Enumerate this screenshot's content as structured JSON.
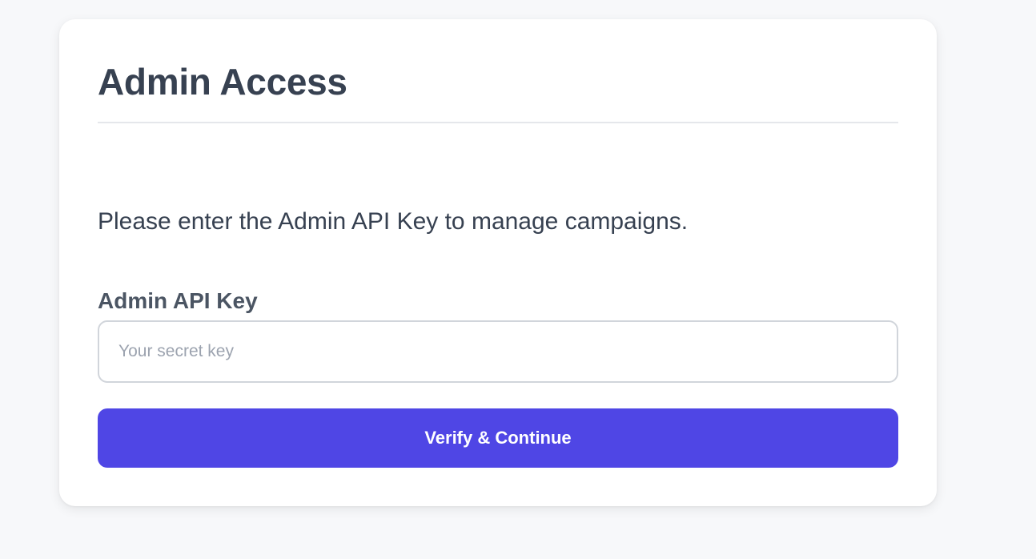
{
  "card": {
    "title": "Admin Access",
    "instructions": "Please enter the Admin API Key to manage campaigns.",
    "field": {
      "label": "Admin API Key",
      "value": "",
      "placeholder": "Your secret key"
    },
    "submit_label": "Verify & Continue"
  },
  "colors": {
    "page_background": "#f7f8fa",
    "card_background": "#ffffff",
    "text_primary": "#374151",
    "text_label": "#4b5563",
    "placeholder": "#9ca3af",
    "input_border": "#d1d5db",
    "divider": "#e5e7eb",
    "accent": "#4f46e5",
    "button_text": "#ffffff"
  }
}
